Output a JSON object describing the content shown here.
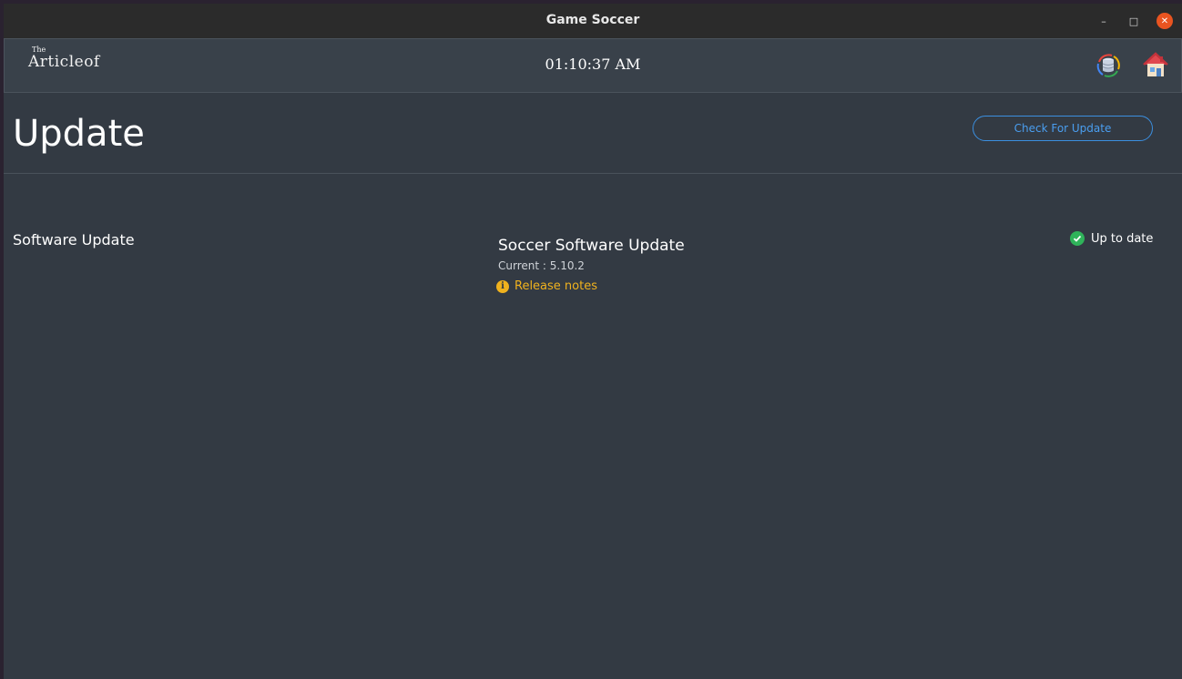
{
  "window": {
    "title": "Game Soccer",
    "controls": {
      "minimize": "–",
      "maximize": "□",
      "close": "✕"
    }
  },
  "header": {
    "logo_small": "The",
    "logo_main": "Articleof",
    "clock": "01:10:37 AM",
    "icons": [
      "database-sync-icon",
      "home-icon"
    ]
  },
  "page": {
    "title": "Update",
    "check_button": "Check For Update"
  },
  "software_update": {
    "section_label": "Software Update",
    "product_title": "Soccer Software Update",
    "current_version": "Current : 5.10.2",
    "release_notes": "Release notes",
    "status": "Up to date"
  },
  "colors": {
    "accent_blue": "#3b8fe0",
    "warning": "#f0b21e",
    "success": "#2fb35a",
    "close_button": "#e95420"
  }
}
